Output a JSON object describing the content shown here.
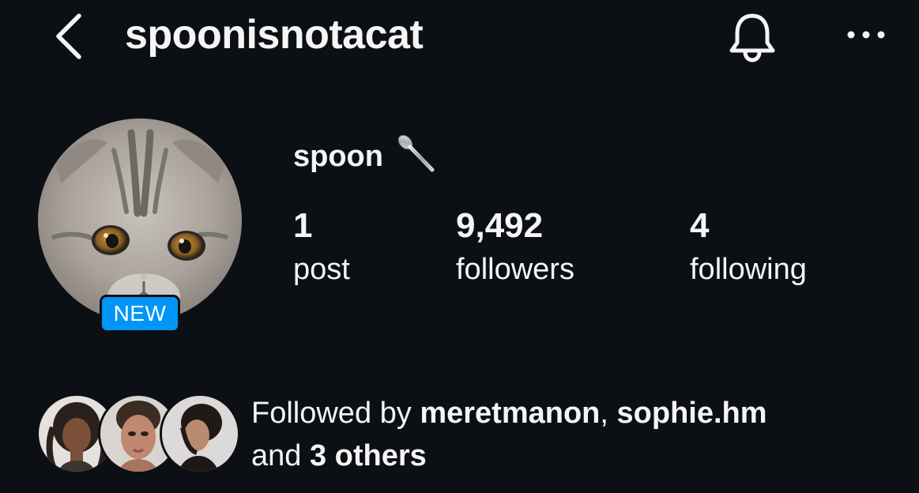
{
  "header": {
    "username": "spoonisnotacat",
    "back_icon": "chevron-left-icon",
    "notifications_icon": "bell-icon",
    "more_icon": "more-horizontal-icon"
  },
  "profile": {
    "display_name": "spoon",
    "display_emoji": "🥄",
    "avatar_description_icon": "cat-avatar",
    "new_badge": "NEW"
  },
  "stats": [
    {
      "value": "1",
      "label": "post"
    },
    {
      "value": "9,492",
      "label": "followers"
    },
    {
      "value": "4",
      "label": "following"
    }
  ],
  "followed_by": {
    "prefix": "Followed by ",
    "user1": "meretmanon",
    "separator": ", ",
    "user2": "sophie.hm",
    "conjunction": "and ",
    "others": "3 others"
  },
  "colors": {
    "background": "#0c1014",
    "text": "#f5f5f5",
    "badge": "#0095f6"
  }
}
